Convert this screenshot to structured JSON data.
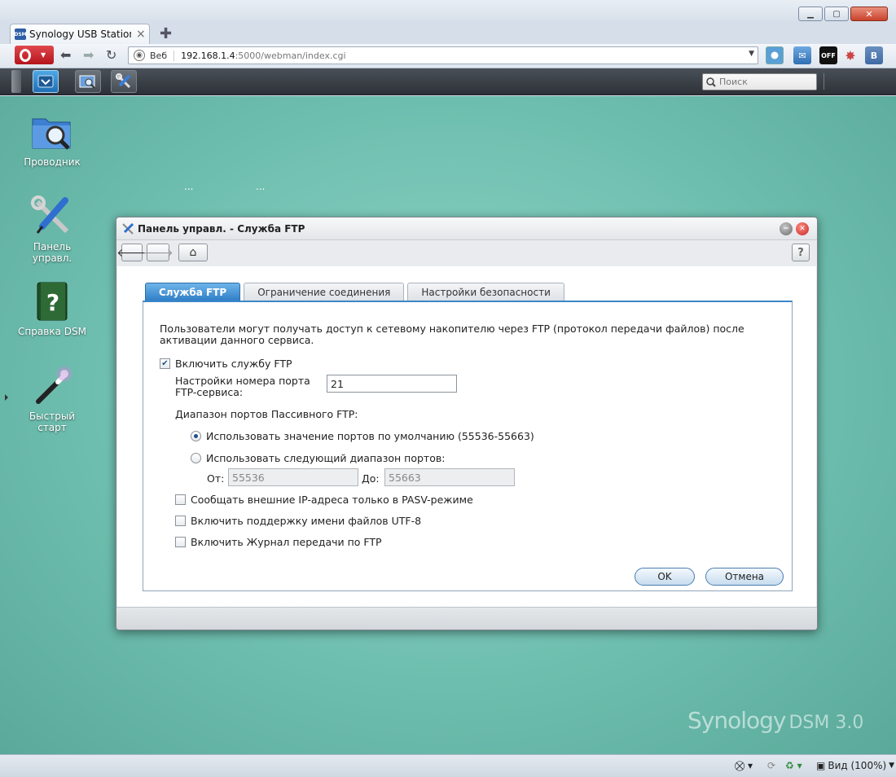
{
  "browser": {
    "tab_title": "Synology USB Station -...",
    "tab_favicon": "DSM",
    "new_tab_icon": "plus-icon",
    "url_label": "Веб",
    "url_host": "192.168.1.4",
    "url_path": ":5000/webman/index.cgi",
    "ext_vk_label": "B",
    "ext_off_label": "OFF",
    "status_zoom": "Вид (100%)",
    "window_controls": [
      "minimize-icon",
      "maximize-icon",
      "close-icon"
    ]
  },
  "taskbar": {
    "search_placeholder": "Поиск"
  },
  "desktop": {
    "icons": [
      {
        "label": "Проводник",
        "icon": "file-browser-icon"
      },
      {
        "label": "Панель управл.",
        "icon": "control-panel-icon"
      },
      {
        "label": "Справка DSM",
        "icon": "help-book-icon"
      },
      {
        "label": "Быстрый старт",
        "icon": "magic-wand-icon"
      }
    ],
    "dots": "...",
    "brand_name": "Synology",
    "brand_product": "DSM 3.0"
  },
  "dialog": {
    "title": "Панель управл. - Служба FTP",
    "help_label": "?",
    "tabs": [
      "Служба FTP",
      "Ограничение соединения",
      "Настройки безопасности"
    ],
    "description": "Пользователи могут получать доступ к сетевому накопителю через FTP (протокол передачи файлов) после активации данного сервиса.",
    "enable_ftp": {
      "label": "Включить службу FTP",
      "checked": true
    },
    "port_label": "Настройки номера порта FTP-сервиса:",
    "port_value": "21",
    "passive_label": "Диапазон портов Пассивного FTP:",
    "radio_default": {
      "label": "Использовать значение портов по умолчанию (55536-55663)",
      "selected": true
    },
    "radio_custom": {
      "label": "Использовать следующий диапазон портов:",
      "selected": false
    },
    "from_label": "От:",
    "from_value": "55536",
    "to_label": "До:",
    "to_value": "55663",
    "options": [
      {
        "label": "Сообщать внешние IP-адреса только в PASV-режиме",
        "checked": false
      },
      {
        "label": "Включить поддержку имени файлов UTF-8",
        "checked": false
      },
      {
        "label": "Включить Журнал передачи по FTP",
        "checked": false
      }
    ],
    "ok_label": "OK",
    "cancel_label": "Отмена"
  }
}
